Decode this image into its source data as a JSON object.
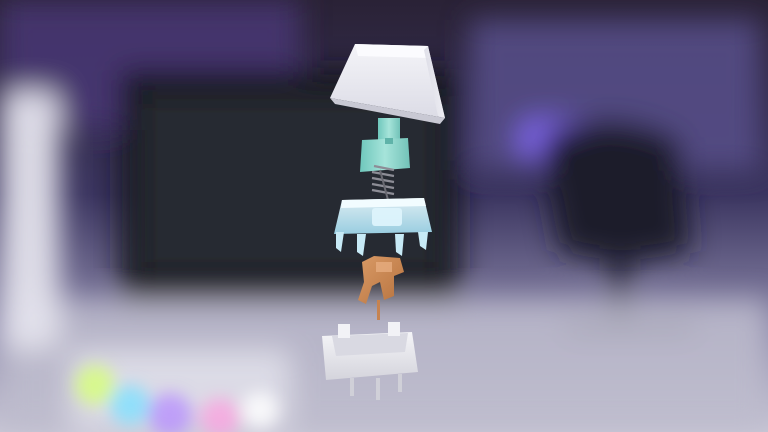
{
  "scene": {
    "subject": "exploded-mechanical-keyboard-switch",
    "layers": [
      {
        "name": "keycap",
        "color": "#e9e9f0"
      },
      {
        "name": "stem",
        "color": "#8ed8d0"
      },
      {
        "name": "spring",
        "color": "#9a9aa2"
      },
      {
        "name": "top-housing",
        "color": "#bfe6f2"
      },
      {
        "name": "contact-leaf",
        "color": "#c98856"
      },
      {
        "name": "bottom-housing",
        "color": "#e6e6ea"
      }
    ],
    "background": {
      "palette": [
        "#2a1f3f",
        "#4b3f7a",
        "#6a5aa0",
        "#9c8fc8",
        "#d8d6e6"
      ],
      "elements": [
        "monitor",
        "desk",
        "chair",
        "speaker",
        "rgb-keyboard"
      ]
    }
  }
}
